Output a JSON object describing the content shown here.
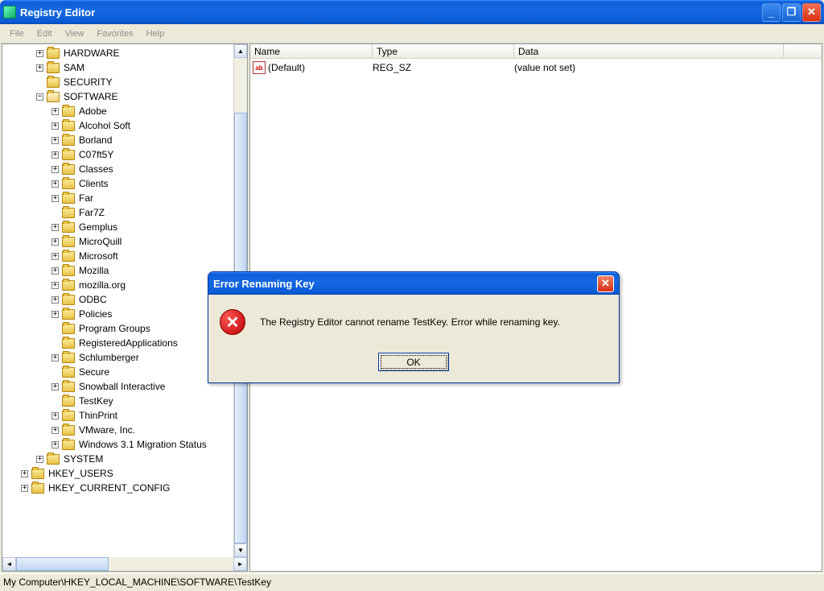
{
  "window": {
    "title": "Registry Editor"
  },
  "menu": [
    "File",
    "Edit",
    "View",
    "Favorites",
    "Help"
  ],
  "tree": [
    {
      "indent": 2,
      "pm": "+",
      "label": "HARDWARE"
    },
    {
      "indent": 2,
      "pm": "+",
      "label": "SAM"
    },
    {
      "indent": 2,
      "pm": " ",
      "label": "SECURITY"
    },
    {
      "indent": 2,
      "pm": "-",
      "open": true,
      "label": "SOFTWARE"
    },
    {
      "indent": 3,
      "pm": "+",
      "label": "Adobe"
    },
    {
      "indent": 3,
      "pm": "+",
      "label": "Alcohol Soft"
    },
    {
      "indent": 3,
      "pm": "+",
      "label": "Borland"
    },
    {
      "indent": 3,
      "pm": "+",
      "label": "C07ft5Y"
    },
    {
      "indent": 3,
      "pm": "+",
      "label": "Classes"
    },
    {
      "indent": 3,
      "pm": "+",
      "label": "Clients"
    },
    {
      "indent": 3,
      "pm": "+",
      "label": "Far"
    },
    {
      "indent": 3,
      "pm": " ",
      "label": "Far7Z"
    },
    {
      "indent": 3,
      "pm": "+",
      "label": "Gemplus"
    },
    {
      "indent": 3,
      "pm": "+",
      "label": "MicroQuill"
    },
    {
      "indent": 3,
      "pm": "+",
      "label": "Microsoft"
    },
    {
      "indent": 3,
      "pm": "+",
      "label": "Mozilla"
    },
    {
      "indent": 3,
      "pm": "+",
      "label": "mozilla.org"
    },
    {
      "indent": 3,
      "pm": "+",
      "label": "ODBC"
    },
    {
      "indent": 3,
      "pm": "+",
      "label": "Policies"
    },
    {
      "indent": 3,
      "pm": " ",
      "label": "Program Groups"
    },
    {
      "indent": 3,
      "pm": " ",
      "label": "RegisteredApplications"
    },
    {
      "indent": 3,
      "pm": "+",
      "label": "Schlumberger"
    },
    {
      "indent": 3,
      "pm": " ",
      "label": "Secure"
    },
    {
      "indent": 3,
      "pm": "+",
      "label": "Snowball Interactive"
    },
    {
      "indent": 3,
      "pm": " ",
      "label": "TestKey"
    },
    {
      "indent": 3,
      "pm": "+",
      "label": "ThinPrint"
    },
    {
      "indent": 3,
      "pm": "+",
      "label": "VMware, Inc."
    },
    {
      "indent": 3,
      "pm": "+",
      "label": "Windows 3.1 Migration Status"
    },
    {
      "indent": 2,
      "pm": "+",
      "label": "SYSTEM"
    },
    {
      "indent": 1,
      "pm": "+",
      "label": "HKEY_USERS"
    },
    {
      "indent": 1,
      "pm": "+",
      "label": "HKEY_CURRENT_CONFIG"
    }
  ],
  "list": {
    "headers": {
      "name": "Name",
      "type": "Type",
      "data": "Data"
    },
    "rows": [
      {
        "name": "(Default)",
        "type": "REG_SZ",
        "data": "(value not set)"
      }
    ]
  },
  "statusbar": "My Computer\\HKEY_LOCAL_MACHINE\\SOFTWARE\\TestKey",
  "dialog": {
    "title": "Error Renaming Key",
    "message": "The Registry Editor cannot rename TestKey. Error while renaming key.",
    "ok": "OK"
  }
}
